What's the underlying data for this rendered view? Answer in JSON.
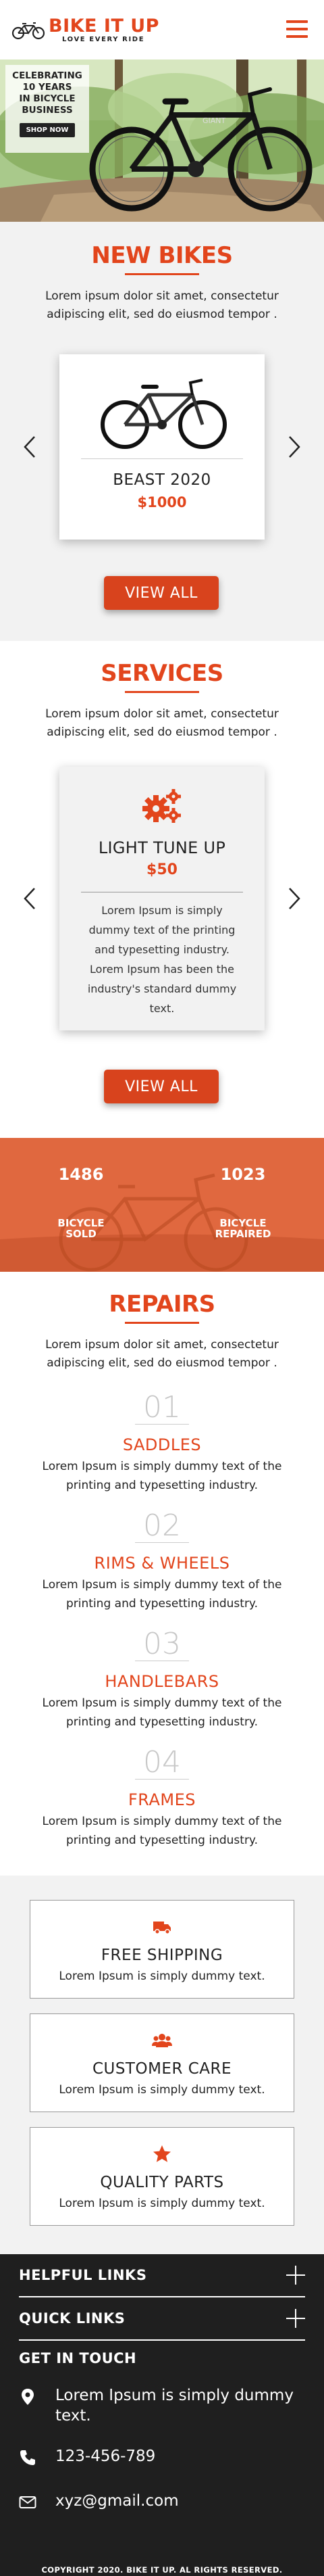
{
  "header": {
    "brand": "BIKE IT UP",
    "tagline": "LOVE EVERY RIDE"
  },
  "hero": {
    "lines": [
      "CELEBRATING",
      "10 YEARS",
      "IN BICYCLE",
      "BUSINESS"
    ],
    "button_label": "SHOP NOW"
  },
  "new_bikes": {
    "title": "NEW BIKES",
    "lead": "Lorem ipsum dolor sit amet, consectetur adipiscing elit, sed do eiusmod tempor .",
    "product_name": "BEAST 2020",
    "product_price": "$1000",
    "button_label": "VIEW ALL"
  },
  "services": {
    "title": "SERVICES",
    "lead": "Lorem ipsum dolor sit amet, consectetur adipiscing elit, sed do eiusmod tempor .",
    "service_name": "LIGHT TUNE UP",
    "service_price": "$50",
    "service_desc": "Lorem Ipsum is simply dummy text of the printing and typesetting industry. Lorem Ipsum has been the industry's standard dummy text.",
    "button_label": "VIEW ALL"
  },
  "stats": {
    "sold_num": "1486",
    "sold_label_1": "BICYCLE",
    "sold_label_2": "SOLD",
    "repaired_num": "1023",
    "repaired_label_1": "BICYCLE",
    "repaired_label_2": "REPAIRED"
  },
  "repairs": {
    "title": "REPAIRS",
    "lead": "Lorem ipsum dolor sit amet, consectetur adipiscing elit, sed do eiusmod tempor .",
    "items": [
      {
        "num": "01",
        "name": "SADDLES",
        "desc": "Lorem Ipsum is simply dummy text of the printing and typesetting industry."
      },
      {
        "num": "02",
        "name": "RIMS & WHEELS",
        "desc": "Lorem Ipsum is simply dummy text of the printing and typesetting industry."
      },
      {
        "num": "03",
        "name": "HANDLEBARS",
        "desc": "Lorem Ipsum is simply dummy text of the printing and typesetting industry."
      },
      {
        "num": "04",
        "name": "FRAMES",
        "desc": "Lorem Ipsum is simply dummy text of the printing and typesetting industry."
      }
    ]
  },
  "features": [
    {
      "icon": "truck-icon",
      "title": "FREE SHIPPING",
      "desc": "Lorem Ipsum is simply dummy text."
    },
    {
      "icon": "users-icon",
      "title": "CUSTOMER CARE",
      "desc": "Lorem Ipsum is simply dummy text."
    },
    {
      "icon": "star-icon",
      "title": "QUALITY PARTS",
      "desc": "Lorem Ipsum is simply dummy text."
    }
  ],
  "footer": {
    "helpful_links": "HELPFUL LINKS",
    "quick_links": "QUICK LINKS",
    "get_in_touch": "GET IN TOUCH",
    "address": "Lorem Ipsum is simply dummy text.",
    "phone": "123-456-789",
    "email": "xyz@gmail.com",
    "copyright": "COPYRIGHT 2020. BIKE IT UP. AL RIGHTS RESERVED."
  },
  "colors": {
    "accent": "#e2451c",
    "footer_bg": "#1f1f1f",
    "section_grey": "#f2f2f2"
  }
}
